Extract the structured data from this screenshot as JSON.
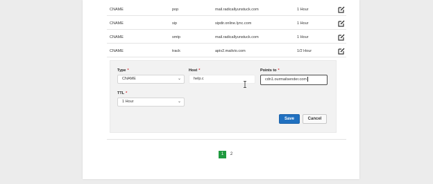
{
  "records": [
    {
      "type": "CNAME",
      "host": "pop",
      "points_to": "mail.radicallyunstuck.com",
      "ttl": "1 Hour"
    },
    {
      "type": "CNAME",
      "host": "sip",
      "points_to": "sipdir.online.lync.com",
      "ttl": "1 Hour"
    },
    {
      "type": "CNAME",
      "host": "smtp",
      "points_to": "mail.radicallyunstuck.com",
      "ttl": "1 Hour"
    },
    {
      "type": "CNAME",
      "host": "track",
      "points_to": "apiv2.mailvio.com",
      "ttl": "1/2 Hour"
    }
  ],
  "form": {
    "type_label": "Type",
    "type_value": "CNAME",
    "host_label": "Host",
    "host_value": "help.c",
    "points_label": "Points to",
    "points_value": "cdn1.ourmailsender.com",
    "ttl_label": "TTL",
    "ttl_value": "1 Hour",
    "required_mark": "*",
    "save_label": "Save",
    "cancel_label": "Cancel"
  },
  "pagination": {
    "pages": [
      "1",
      "2"
    ],
    "current": "1"
  },
  "colors": {
    "accent": "#2070c0",
    "active_page": "#1f9a3f",
    "required": "#d9282f"
  },
  "icons": {
    "edit": "edit-icon",
    "select_arrow": "chevron-down-icon"
  }
}
